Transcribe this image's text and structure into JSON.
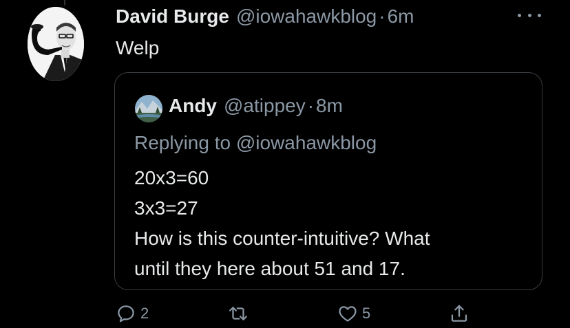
{
  "tweet": {
    "author_name": "David Burge",
    "author_handle": "@iowahawkblog",
    "separator": "·",
    "time": "6m",
    "text": "Welp",
    "avatar_icon": "man-with-pipe-avatar",
    "more_icon": "more-horizontal-icon"
  },
  "quoted_tweet": {
    "author_name": "Andy",
    "author_handle": "@atippey",
    "separator": "·",
    "time": "8m",
    "avatar_icon": "mountain-landscape-avatar",
    "replying_to": "Replying to @iowahawkblog",
    "lines": [
      "20x3=60",
      "3x3=27",
      "How is this counter-intuitive? What",
      "until they here about 51 and 17."
    ]
  },
  "actions": {
    "reply": {
      "icon": "reply-icon",
      "count": "2"
    },
    "retweet": {
      "icon": "retweet-icon",
      "count": ""
    },
    "like": {
      "icon": "heart-icon",
      "count": "5"
    },
    "share": {
      "icon": "share-icon",
      "count": ""
    }
  },
  "colors": {
    "background": "#000000",
    "text_primary": "#e7e9ea",
    "text_secondary": "#8b98a5",
    "border": "#3a3f44"
  }
}
